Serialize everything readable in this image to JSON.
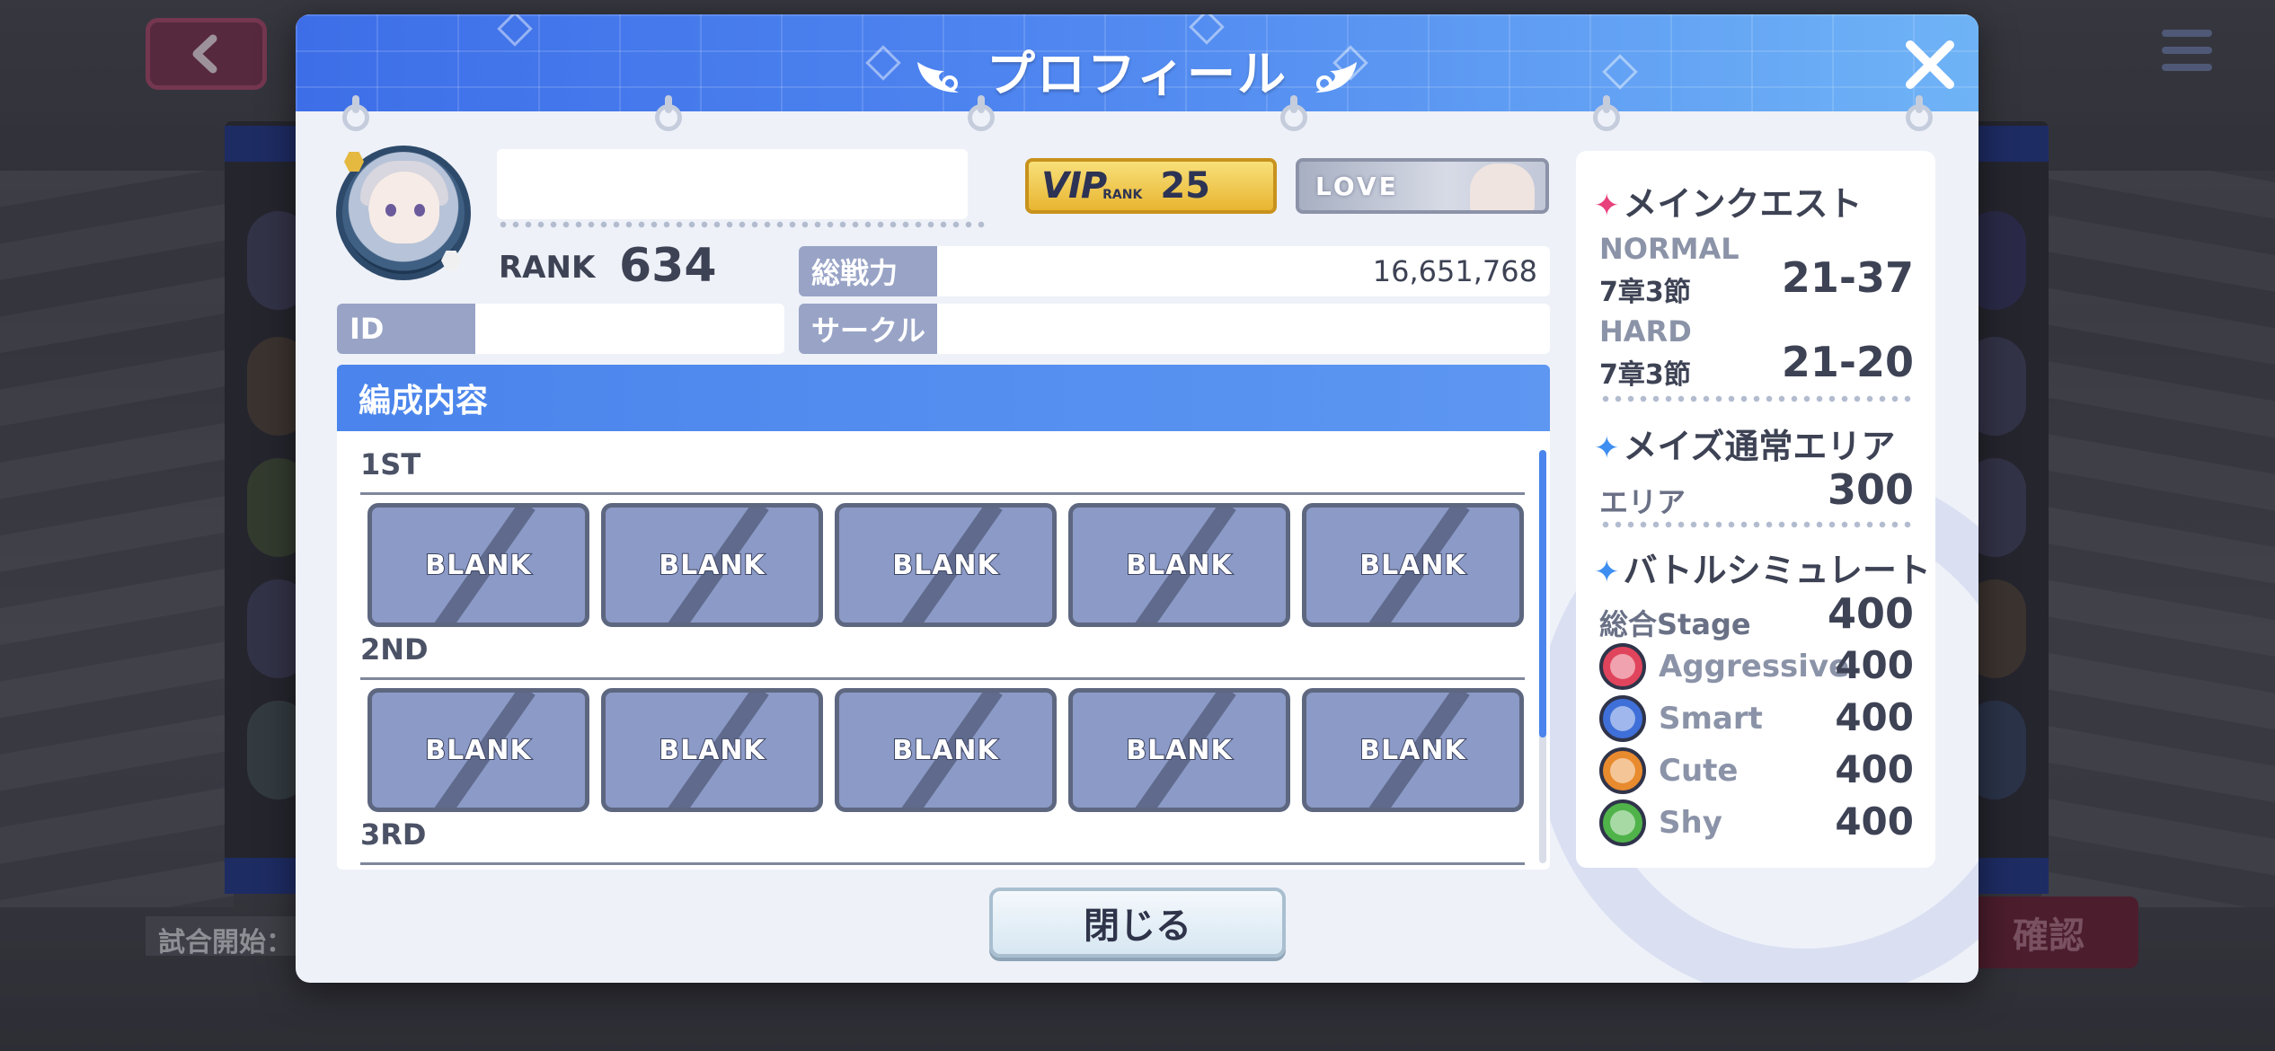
{
  "modal": {
    "title": "プロフィール",
    "close_button_label": "閉じる"
  },
  "profile": {
    "player_name": "",
    "rank_label": "RANK",
    "rank_value": "634",
    "vip_text": "VIP",
    "vip_rank_small": "RANK",
    "vip_level": "25",
    "love_text": "LOVE",
    "total_power_label": "総戦力",
    "total_power_value": "16,651,768",
    "id_label": "ID",
    "id_value": "",
    "circle_label": "サークル",
    "circle_value": ""
  },
  "formation": {
    "title": "編成内容",
    "teams": [
      {
        "label": "1ST",
        "slots": [
          "BLANK",
          "BLANK",
          "BLANK",
          "BLANK",
          "BLANK"
        ]
      },
      {
        "label": "2ND",
        "slots": [
          "BLANK",
          "BLANK",
          "BLANK",
          "BLANK",
          "BLANK"
        ]
      },
      {
        "label": "3RD",
        "slots": []
      }
    ]
  },
  "stats": {
    "main_quest": {
      "title": "メインクエスト",
      "normal_label": "NORMAL",
      "normal_chapter": "7章3節",
      "normal_value": "21-37",
      "hard_label": "HARD",
      "hard_chapter": "7章3節",
      "hard_value": "21-20"
    },
    "maze": {
      "title": "メイズ通常エリア",
      "area_label": "エリア",
      "area_value": "300"
    },
    "battle_sim": {
      "title": "バトルシミュレート",
      "total_label": "総合Stage",
      "total_value": "400",
      "types": [
        {
          "name": "Aggressive",
          "value": "400",
          "color": "#e0445c"
        },
        {
          "name": "Smart",
          "value": "400",
          "color": "#3f6fd8"
        },
        {
          "name": "Cute",
          "value": "400",
          "color": "#e88a2e"
        },
        {
          "name": "Shy",
          "value": "400",
          "color": "#4fb34a"
        }
      ]
    }
  },
  "background": {
    "match_start_label": "試合開始：",
    "confirm_label": "確認"
  },
  "colors": {
    "header_blue": "#3d6ee8",
    "formation_header": "#4a84ec",
    "slot_fill": "#8b9ac6",
    "label_fill": "#98a3c6",
    "main_quest_sparkle": "#e8407c",
    "section_sparkle": "#3d8ef0"
  },
  "icons": [
    "back-arrow-icon",
    "menu-icon",
    "wing-icon",
    "close-icon",
    "sparkle-icon",
    "type-icon"
  ]
}
